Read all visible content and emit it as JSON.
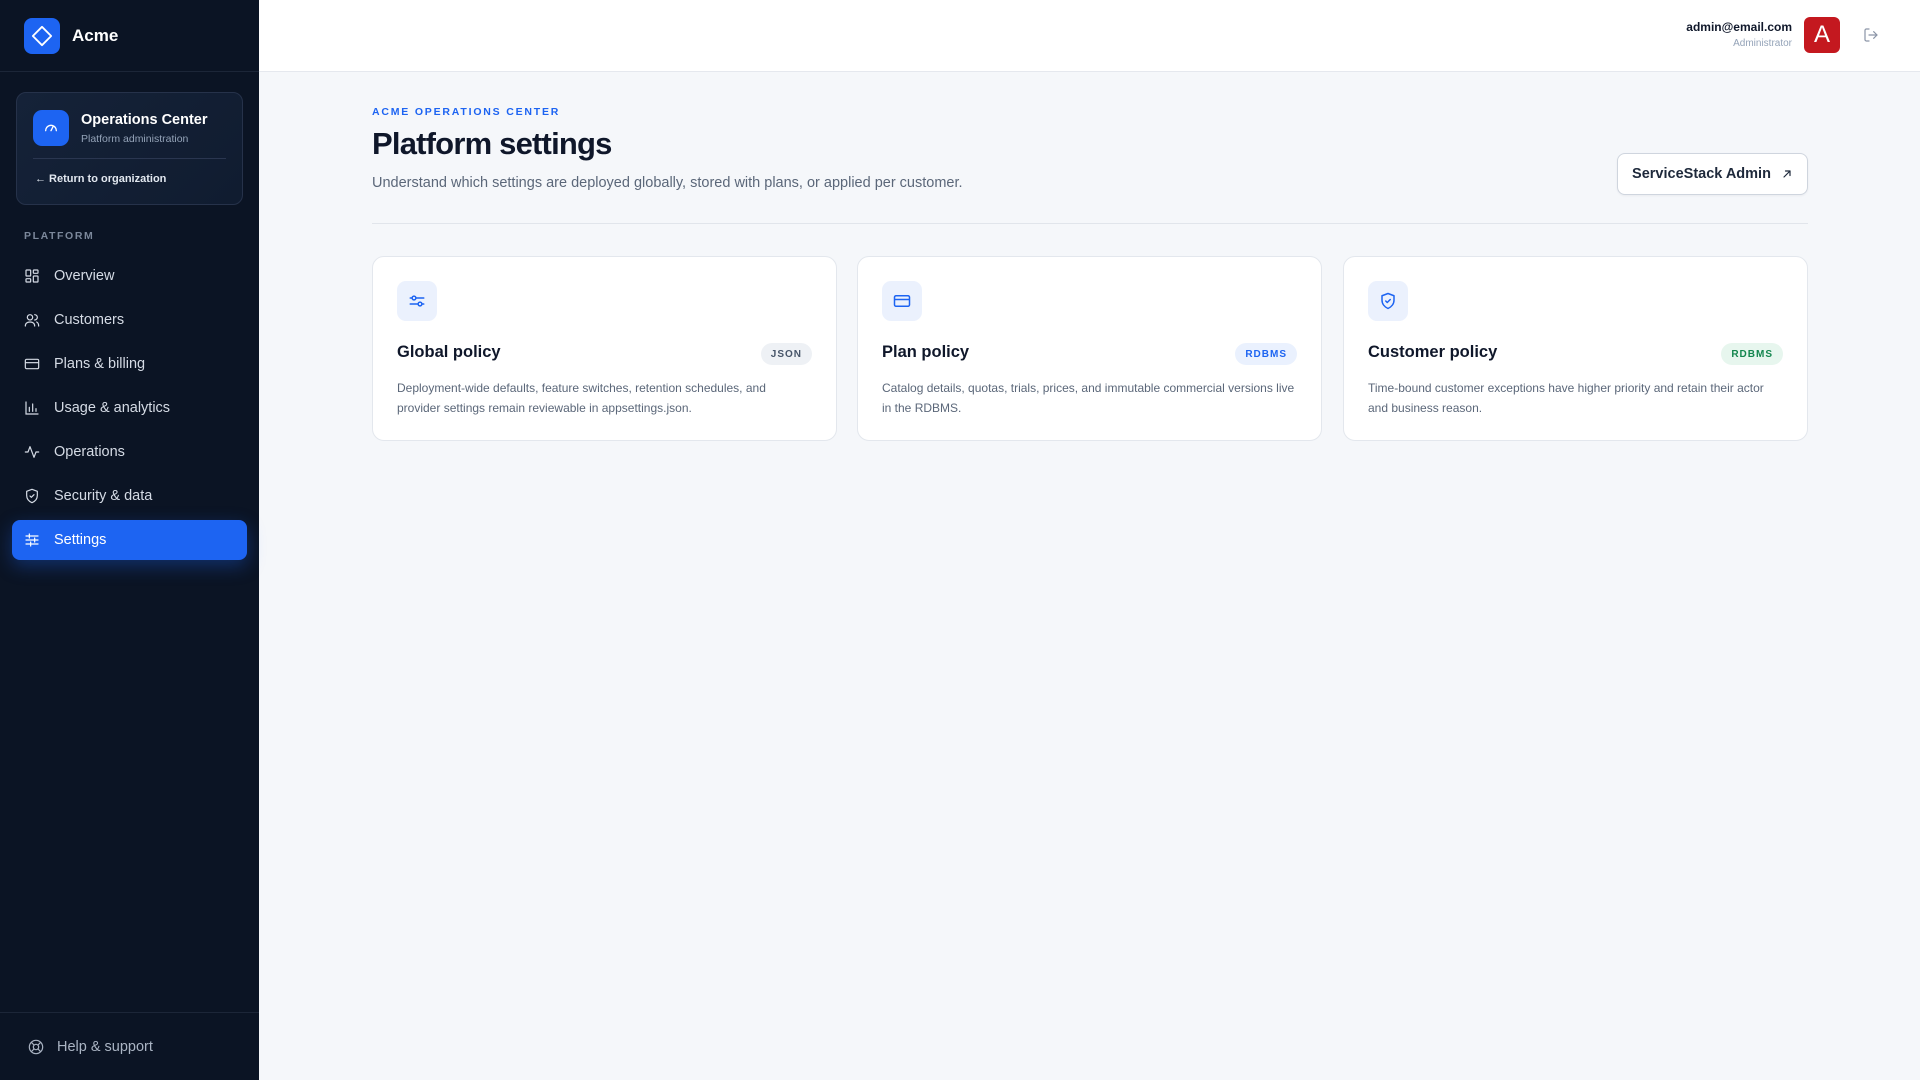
{
  "brand": {
    "name": "Acme"
  },
  "ops_card": {
    "title": "Operations Center",
    "subtitle": "Platform administration",
    "return_label": "← Return to organization"
  },
  "sidebar": {
    "section_label": "PLATFORM",
    "items": [
      {
        "label": "Overview",
        "icon": "dashboard-icon",
        "active": false
      },
      {
        "label": "Customers",
        "icon": "users-icon",
        "active": false
      },
      {
        "label": "Plans & billing",
        "icon": "credit-card-icon",
        "active": false
      },
      {
        "label": "Usage & analytics",
        "icon": "bar-chart-icon",
        "active": false
      },
      {
        "label": "Operations",
        "icon": "activity-icon",
        "active": false
      },
      {
        "label": "Security & data",
        "icon": "shield-check-icon",
        "active": false
      },
      {
        "label": "Settings",
        "icon": "sliders-icon",
        "active": true
      }
    ],
    "help_label": "Help & support"
  },
  "header": {
    "user_email": "admin@email.com",
    "user_role": "Administrator",
    "avatar_letter": "A",
    "avatar_color": "#c4181f"
  },
  "main": {
    "eyebrow": "ACME OPERATIONS CENTER",
    "title": "Platform settings",
    "description": "Understand which settings are deployed globally, stored with plans, or applied per customer.",
    "action_button": "ServiceStack Admin",
    "cards": [
      {
        "title": "Global policy",
        "badge": "JSON",
        "description": "Deployment-wide defaults, feature switches, retention schedules, and provider settings remain reviewable in appsettings.json.",
        "icon": "sliders-icon"
      },
      {
        "title": "Plan policy",
        "badge": "RDBMS",
        "description": "Catalog details, quotas, trials, prices, and immutable commercial versions live in the RDBMS.",
        "icon": "credit-card-icon"
      },
      {
        "title": "Customer policy",
        "badge": "RDBMS",
        "description": "Time-bound customer exceptions have higher priority and retain their actor and business reason.",
        "icon": "shield-check-icon"
      }
    ]
  },
  "colors": {
    "accent": "#1d64f2",
    "sidebar_bg": "#0b1424",
    "page_bg": "#f5f7fa",
    "badge_green": "#13864e"
  }
}
